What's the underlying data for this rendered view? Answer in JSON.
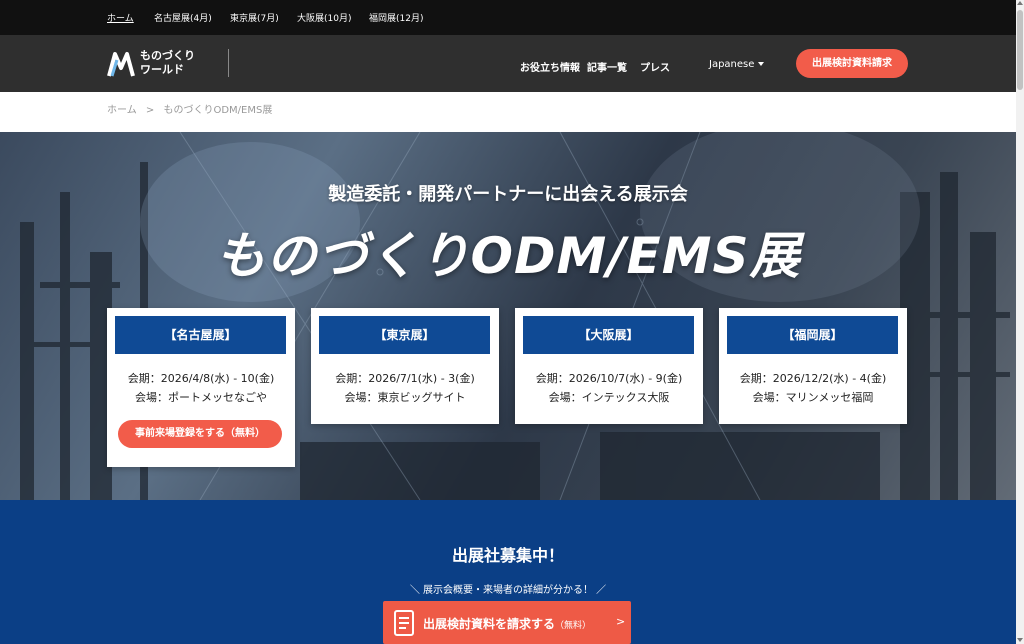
{
  "topnav": {
    "items": [
      "ホーム",
      "名古屋展(4月)",
      "東京展(7月)",
      "大阪展(10月)",
      "福岡展(12月)"
    ]
  },
  "header": {
    "logo_line1": "ものづくり",
    "logo_line2": "ワールド",
    "nav": [
      "お役立ち情報",
      "記事一覧",
      "プレス"
    ],
    "language": "Japanese",
    "cta": "出展検討資料請求"
  },
  "breadcrumb": {
    "home": "ホーム",
    "separator": ">",
    "current": "ものづくりODM/EMS展"
  },
  "hero": {
    "subtitle": "製造委託・開発パートナーに出会える展示会",
    "title": "ものづくりODM/EMS展",
    "cards": [
      {
        "title": "【名古屋展】",
        "dates": "会期：2026/4/8(水) - 10(金)",
        "venue": "会場：ポートメッセなごや",
        "button": "事前来場登録をする（無料）"
      },
      {
        "title": "【東京展】",
        "dates": "会期：2026/7/1(水) - 3(金)",
        "venue": "会場：東京ビッグサイト"
      },
      {
        "title": "【大阪展】",
        "dates": "会期：2026/10/7(水) - 9(金)",
        "venue": "会場：インテックス大阪"
      },
      {
        "title": "【福岡展】",
        "dates": "会期：2026/12/2(水) - 4(金)",
        "venue": "会場：マリンメッセ福岡"
      }
    ]
  },
  "recruit": {
    "title": "出展社募集中！",
    "subtitle": "＼ 展示会概要・来場者の詳細が分かる！ ／",
    "button_main": "出展検討資料を請求する",
    "button_small": "（無料）",
    "button_chevron": ">"
  },
  "colors": {
    "accent": "#f25c4a",
    "brand_blue": "#0f4a95",
    "header_bg": "#2f2f2f"
  }
}
